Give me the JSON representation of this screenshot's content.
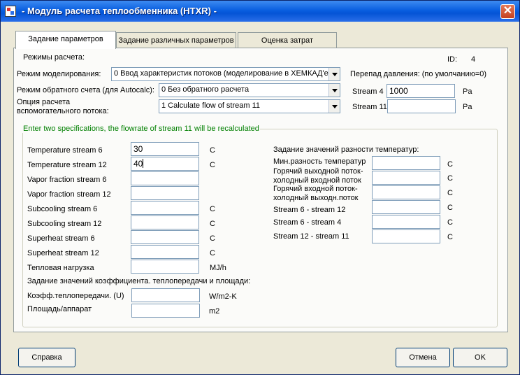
{
  "window": {
    "title": "- Модуль расчета теплообменника (HTXR) -",
    "close": "✕"
  },
  "tabs": [
    {
      "label": "Задание параметров",
      "active": true
    },
    {
      "label": "Задание различных параметров",
      "active": false
    },
    {
      "label": "Оценка затрат",
      "active": false
    }
  ],
  "calc_modes": {
    "heading": "Режимы расчета:",
    "id_label": "ID:",
    "id_value": "4",
    "modeling_label": "Режим моделирования:",
    "modeling_value": "0 Ввод характеристик потоков (моделирование в ХЕМКАД'е",
    "backcalc_label": "Режим обратного счета (для Autocalc):",
    "backcalc_value": "0 Без обратного расчета",
    "aux_label_line1": "Опция расчета",
    "aux_label_line2": "вспомогательного потока:",
    "aux_value": "1 Calculate flow of stream 11"
  },
  "pressure_drop": {
    "heading": "Перепад давления:  (по умолчанию=0)",
    "stream4_label": "Stream 4",
    "stream4_value": "1000",
    "stream4_unit": "Pa",
    "stream11_label": "Stream 11",
    "stream11_value": "",
    "stream11_unit": "Pa"
  },
  "specs": {
    "legend": "Enter two specifications, the flowrate of stream 11 will be recalculated",
    "fields": [
      {
        "label": "Temperature stream 6",
        "value": "30",
        "unit": "C"
      },
      {
        "label": "Temperature stream 12",
        "value": "40",
        "unit": "C"
      },
      {
        "label": "Vapor fraction stream 6",
        "value": "",
        "unit": ""
      },
      {
        "label": "Vapor fraction stream 12",
        "value": "",
        "unit": ""
      },
      {
        "label": "Subcooling stream 6",
        "value": "",
        "unit": "C"
      },
      {
        "label": "Subcooling stream 12",
        "value": "",
        "unit": "C"
      },
      {
        "label": "Superheat stream 6",
        "value": "",
        "unit": "C"
      },
      {
        "label": "Superheat stream 12",
        "value": "",
        "unit": "C"
      },
      {
        "label": "Тепловая нагрузка",
        "value": "",
        "unit": "MJ/h"
      }
    ],
    "coeff_heading": "Задание значений коэффициента. теплопередачи и площади:",
    "u_label": "Коэфф.теплопередачи. (U)",
    "u_value": "",
    "u_unit": "W/m2-K",
    "area_label": "Площадь/аппарат",
    "area_value": "",
    "area_unit": "m2"
  },
  "temp_diff": {
    "heading": "Задание значений разности температур:",
    "rows": [
      {
        "line1": "Мин.разность температур",
        "line2": "",
        "value": "",
        "unit": "C"
      },
      {
        "line1": "Горячий выходной поток-",
        "line2": "холодный входной поток",
        "value": "",
        "unit": "C"
      },
      {
        "line1": "Горячий входной поток-",
        "line2": "холодный выходн.поток",
        "value": "",
        "unit": "C"
      },
      {
        "line1": "Stream 6 - stream 12",
        "line2": "",
        "value": "",
        "unit": "C"
      },
      {
        "line1": "Stream 6 - stream 4",
        "line2": "",
        "value": "",
        "unit": "C"
      },
      {
        "line1": "Stream 12 - stream 11",
        "line2": "",
        "value": "",
        "unit": "C"
      }
    ]
  },
  "buttons": {
    "help": "Справка",
    "cancel": "Отмена",
    "ok": "OK"
  }
}
